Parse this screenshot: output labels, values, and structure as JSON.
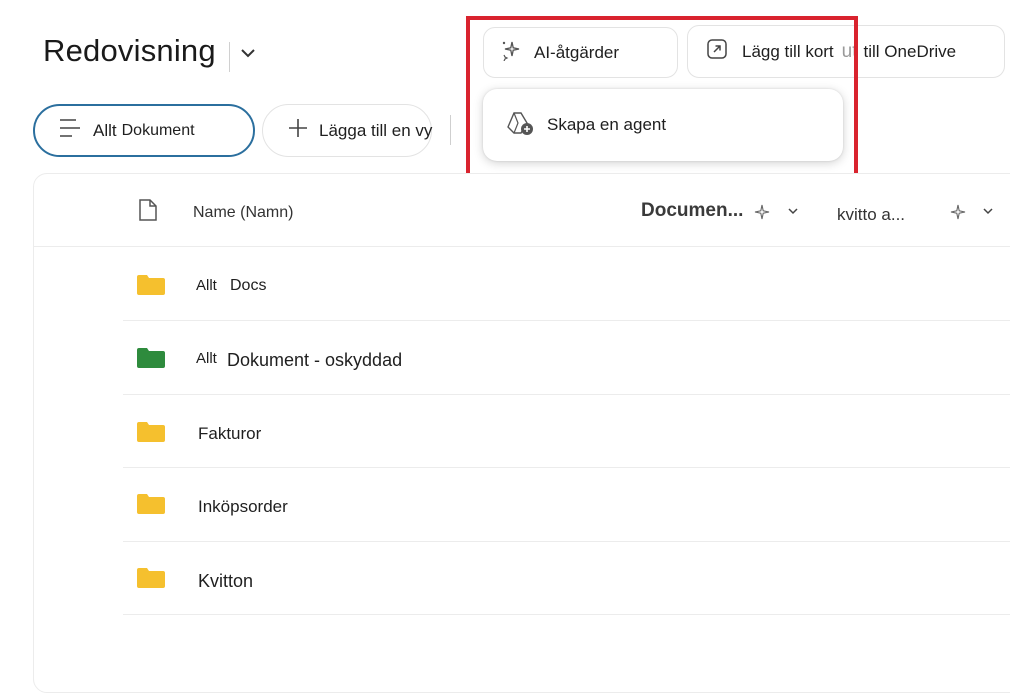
{
  "header": {
    "title": "Redovisning"
  },
  "toolbar": {
    "ai_actions_label": "AI-åtgärder",
    "add_card_label": "Lägg till kort",
    "overlap_text": "ut",
    "onedrive_label": "till OneDrive"
  },
  "ai_menu": {
    "items": [
      {
        "label": "Skapa en agent",
        "icon": "agent-add-icon"
      }
    ]
  },
  "views": {
    "current_prefix": "Allt",
    "current_label": "Dokument",
    "add_view_label": "Lägga till en vy"
  },
  "table": {
    "columns": {
      "name": "Name (Namn)",
      "document": "Documen...",
      "kvitto": "kvitto a..."
    },
    "rows": [
      {
        "prefix": "Allt",
        "name": "Docs",
        "folder_color": "#f5c02e"
      },
      {
        "prefix": "Allt",
        "name": "Dokument - oskyddad",
        "folder_color": "#2e8b3d"
      },
      {
        "prefix": "",
        "name": "Fakturor",
        "folder_color": "#f5c02e"
      },
      {
        "prefix": "",
        "name": "Inköpsorder",
        "folder_color": "#f5c02e"
      },
      {
        "prefix": "",
        "name": "Kvitton",
        "folder_color": "#f5c02e"
      }
    ]
  },
  "colors": {
    "highlight": "#d9232e",
    "active_view_border": "#2b6f9e"
  }
}
